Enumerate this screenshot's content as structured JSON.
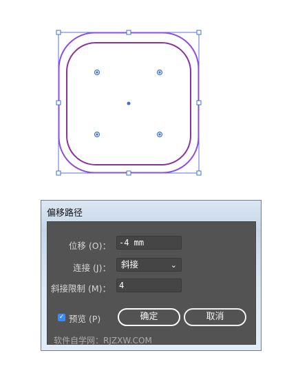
{
  "artwork": {
    "outer_color": "#8a4fe0",
    "inner_color": "#8d2f9c",
    "handle_color": "#3a6fe0",
    "point_color": "#3a6fe0"
  },
  "dialog": {
    "title": "偏移路径",
    "offset": {
      "label": "位移 (O)：",
      "value": "-4 mm"
    },
    "joins": {
      "label": "连接 (J)：",
      "value": "斜接",
      "icon": "chevron-down-icon"
    },
    "miter": {
      "label": "斜接限制 (M)：",
      "value": "4"
    },
    "preview": {
      "label": "预览 (P)",
      "checked": true
    },
    "ok_label": "确定",
    "cancel_label": "取消",
    "watermark": "软件自学网：RJZXW.COM",
    "accent": "#3b8bf5"
  }
}
